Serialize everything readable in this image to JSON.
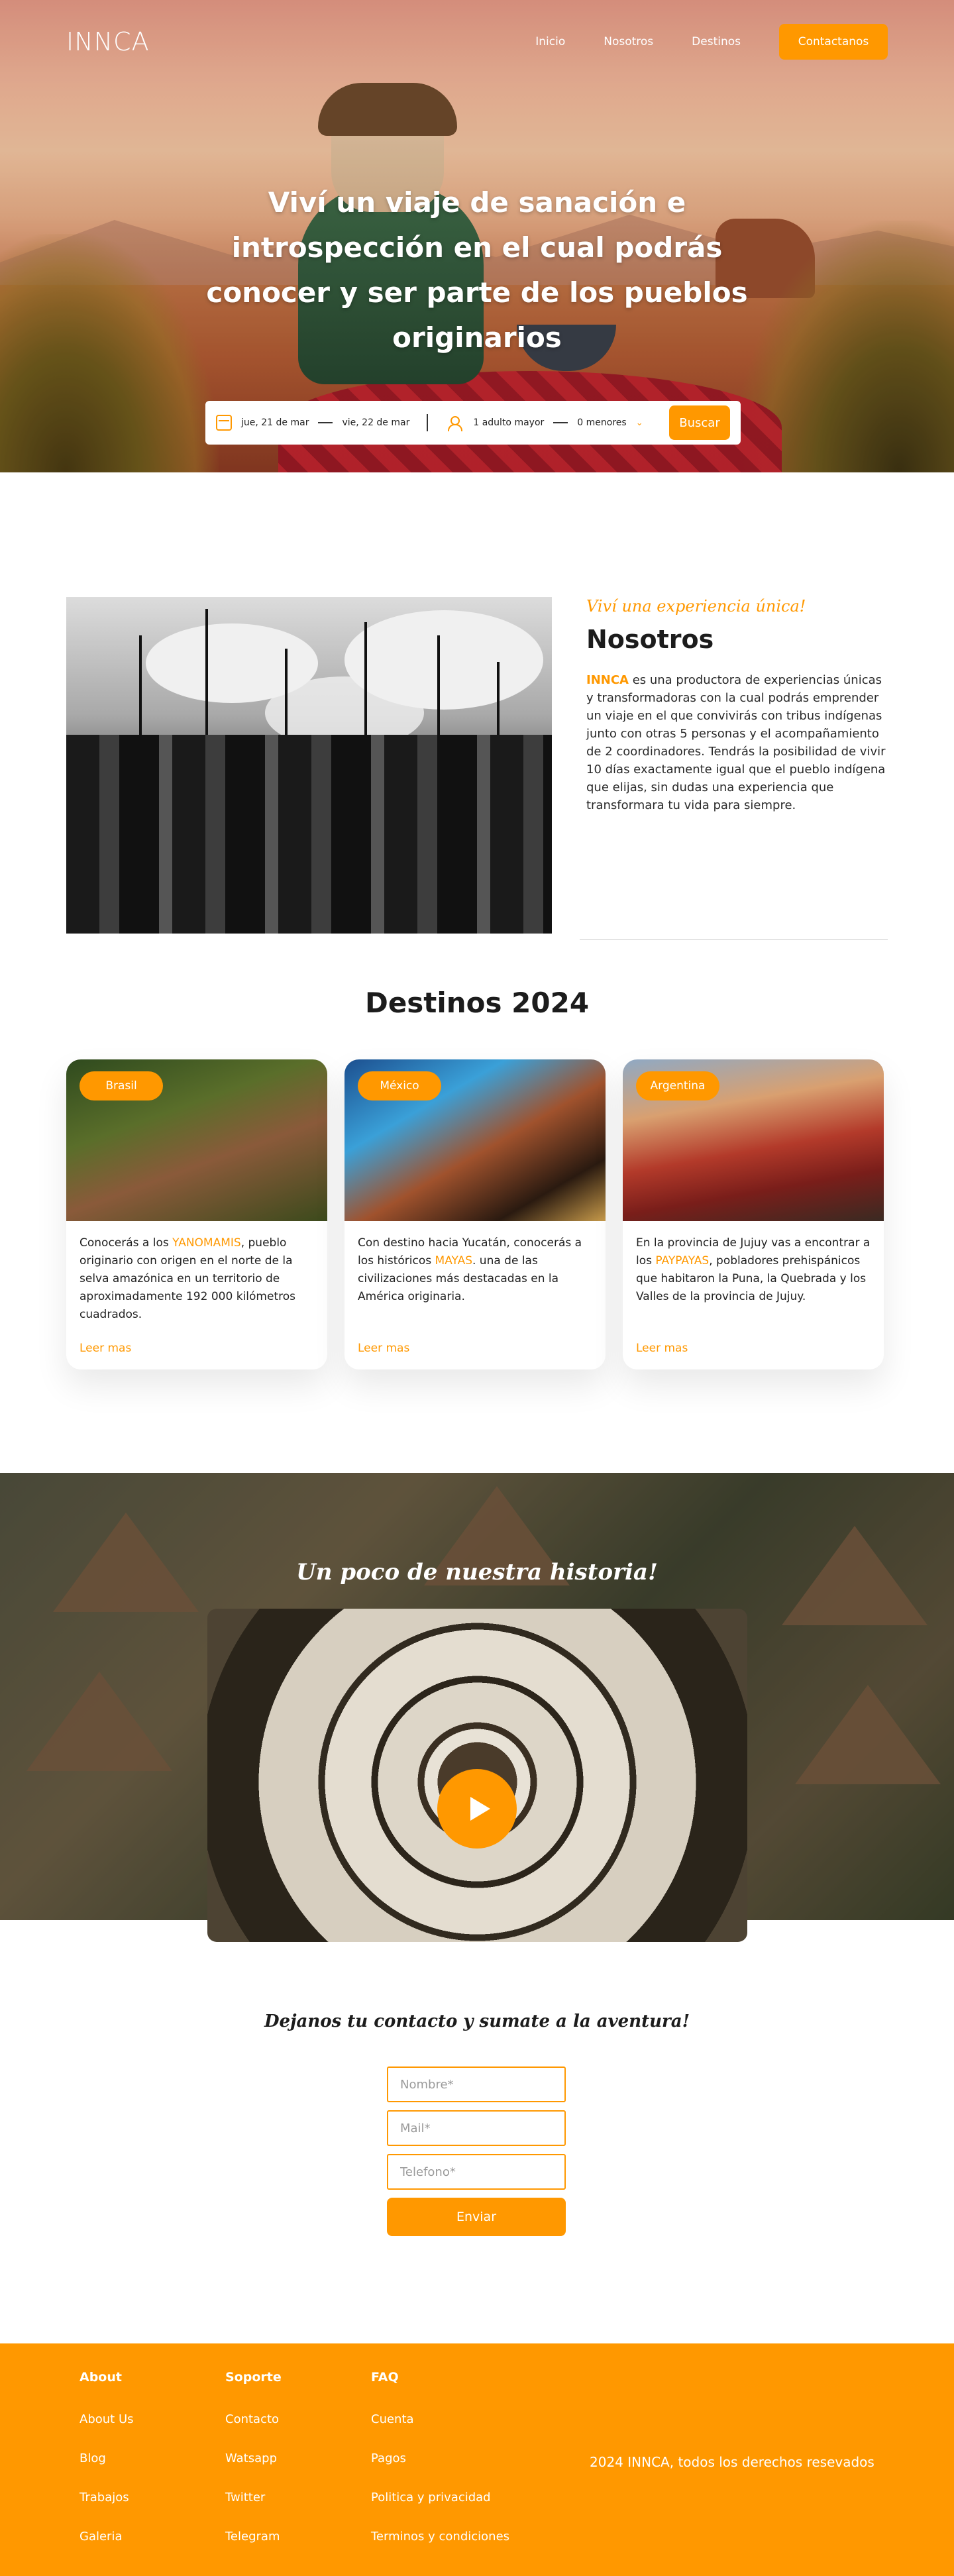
{
  "brand": "INNCA",
  "nav": {
    "links": [
      "Inicio",
      "Nosotros",
      "Destinos"
    ],
    "cta": "Contactanos"
  },
  "hero": {
    "title": "Viví un viaje de sanación e introspección en el cual podrás conocer y ser parte de los pueblos originarios"
  },
  "search": {
    "checkin": "jue, 21 de mar",
    "checkout": "vie, 22 de mar",
    "adults": "1 adulto mayor",
    "minors": "0 menores",
    "button": "Buscar"
  },
  "about": {
    "tagline": "Viví una experiencia única!",
    "title": "Nosotros",
    "brand_word": "INNCA",
    "body": " es una productora de experiencias únicas y transformadoras con la cual podrás emprender un viaje en el que convivirás con tribus indígenas junto con otras 5 personas y el acompañamiento de 2 coordinadores. Tendrás la posibilidad de vivir 10 días exactamente igual que el pueblo indígena que elijas, sin dudas una experiencia que transformara tu vida para siempre."
  },
  "destinations": {
    "title": "Destinos 2024",
    "cards": [
      {
        "badge": "Brasil",
        "text_before": "Conocerás a los ",
        "highlight": "YANOMAMIS",
        "text_after": ", pueblo originario con origen en el norte de la selva amazónica en un territorio de aproximadamente 192 000 kilómetros cuadrados.",
        "more": "Leer mas"
      },
      {
        "badge": "México",
        "text_before": "Con destino hacia Yucatán, conocerás a los históricos ",
        "highlight": "MAYAS",
        "text_after": ". una de las civilizaciones más destacadas en la América originaria.",
        "more": "Leer mas"
      },
      {
        "badge": "Argentina",
        "text_before": "En la provincia de Jujuy vas a encontrar a los ",
        "highlight": "PAYPAYAS",
        "text_after": ", pobladores prehispánicos que habitaron la Puna, la Quebrada y los Valles de la provincia de Jujuy.",
        "more": "Leer mas"
      }
    ]
  },
  "history": {
    "title": "Un poco de nuestra historia!"
  },
  "contact": {
    "title": "Dejanos tu contacto y sumate a la aventura!",
    "name_placeholder": "Nombre*",
    "mail_placeholder": "Mail*",
    "phone_placeholder": "Telefono*",
    "submit": "Enviar"
  },
  "footer": {
    "columns": [
      {
        "heading": "About",
        "links": [
          "About Us",
          "Blog",
          "Trabajos",
          "Galeria"
        ]
      },
      {
        "heading": "Soporte",
        "links": [
          "Contacto",
          "Watsapp",
          "Twitter",
          "Telegram"
        ]
      },
      {
        "heading": "FAQ",
        "links": [
          "Cuenta",
          "Pagos",
          "Politica y privacidad",
          "Terminos y condiciones"
        ]
      }
    ],
    "copyright": "2024 INNCA, todos los derechos resevados"
  },
  "colors": {
    "accent": "#ff9800",
    "text": "#1c1c1c",
    "footer_bg": "#ff9800"
  },
  "icons": [
    "calendar-icon",
    "user-icon",
    "chevron-down-icon",
    "play-icon"
  ]
}
